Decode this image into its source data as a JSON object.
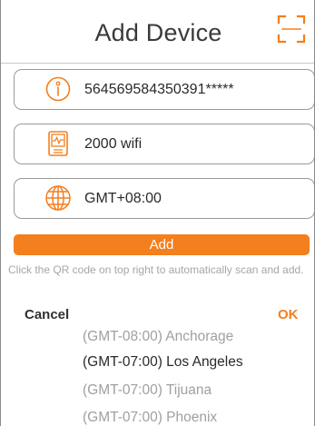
{
  "header": {
    "title": "Add Device",
    "scan_icon": "qr-scan-icon"
  },
  "fields": [
    {
      "icon": "info-icon",
      "value": "564569584350391*****"
    },
    {
      "icon": "router-icon",
      "value": "2000 wifi"
    },
    {
      "icon": "globe-icon",
      "value": "GMT+08:00"
    }
  ],
  "add_button": {
    "label": "Add"
  },
  "hint": "Click the QR code on top right to automatically scan and add.",
  "picker": {
    "cancel_label": "Cancel",
    "ok_label": "OK",
    "options": [
      "(GMT-08:00) Anchorage",
      "(GMT-07:00) Los Angeles",
      "(GMT-07:00) Tijuana",
      "(GMT-07:00) Phoenix"
    ],
    "selected": "(GMT-07:00) Los Angeles"
  },
  "colors": {
    "accent": "#f37f1e",
    "text": "#2a2a2a",
    "muted": "#a0a0a0",
    "border": "#9a9a9a"
  }
}
